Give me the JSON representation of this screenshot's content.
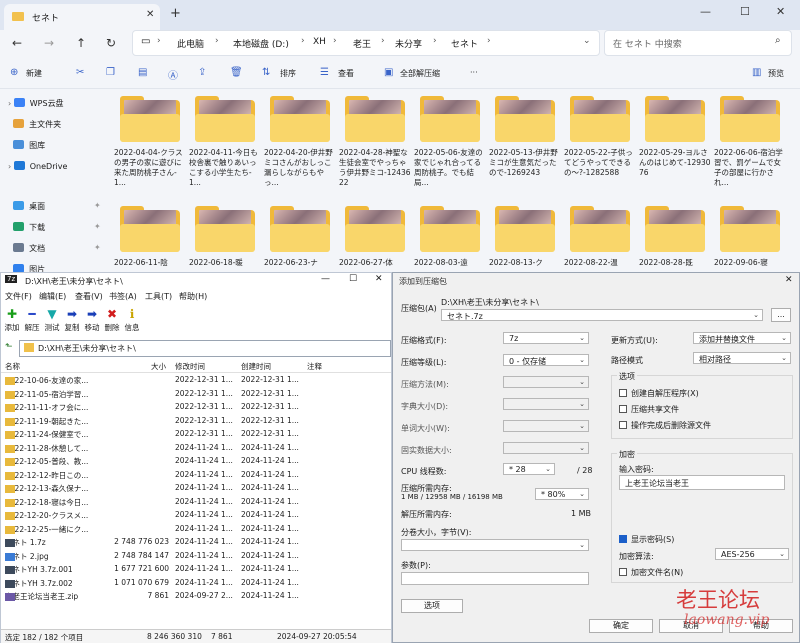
{
  "explorer": {
    "tab_title": "セネト",
    "add_tab": "+",
    "nav": {
      "back": "←",
      "forward": "→",
      "up": "↑",
      "refresh": "↻"
    },
    "breadcrumbs": [
      "此电脑",
      "本地磁盘 (D:)",
      "XH",
      "老王",
      "未分享",
      "セネト"
    ],
    "search_placeholder": "在 セネト 中搜索",
    "commands": {
      "new": "新建",
      "sort": "排序",
      "view": "查看",
      "extract_all": "全部解压缩",
      "preview": "预览"
    },
    "nav_items": [
      {
        "label": "WPS云盘",
        "icon": "cloud-icon"
      },
      {
        "label": "主文件夹",
        "icon": "home-icon"
      },
      {
        "label": "图库",
        "icon": "gallery-icon"
      },
      {
        "label": "OneDrive",
        "icon": "onedrive-icon"
      },
      {
        "label": "桌面",
        "icon": "desktop-icon"
      },
      {
        "label": "下载",
        "icon": "download-icon"
      },
      {
        "label": "文档",
        "icon": "document-icon"
      },
      {
        "label": "图片",
        "icon": "picture-icon"
      }
    ],
    "folders_row1": [
      "2022-04-04-クラスの男子の家に遊びに来た周防桃子さん-1...",
      "2022-04-11-今日も校舎裏で触りあいっこする小学生たち-1...",
      "2022-04-20-伊井野ミコさんがおしっこ漏らしながらもやっ...",
      "2022-04-28-神聖な生徒会室でやっちゃう伊井野ミコ-1243622",
      "2022-05-06-友達の家でじゃれ合ってる周防桃子。でも結局...",
      "2022-05-13-伊井野ミコが生意気だったので-1269243",
      "2022-05-22-子供ってどうやってできるの～?-1282588",
      "2022-05-29-ヨルさんのはじめて-1293076",
      "2022-06-06-宿泊学習で、罰ゲームで女子の部屋に行かされ..."
    ],
    "folders_row2": [
      "2022-06-11-陰",
      "2022-06-18-暖",
      "2022-06-23-ナ",
      "2022-06-27-体",
      "2022-08-03-遠",
      "2022-08-13-ク",
      "2022-08-22-温",
      "2022-08-28-既",
      "2022-09-06-寝"
    ]
  },
  "fm": {
    "title": "D:\\XH\\老王\\未分享\\セネト\\",
    "app_icon": "7z",
    "menu": [
      "文件(F)",
      "编辑(E)",
      "查看(V)",
      "书签(A)",
      "工具(T)",
      "帮助(H)"
    ],
    "tools": [
      {
        "label": "添加",
        "glyph": "✚",
        "color": "#1a9e1a"
      },
      {
        "label": "解压",
        "glyph": "━",
        "color": "#2a49c9"
      },
      {
        "label": "测试",
        "glyph": "▼",
        "color": "#16a8a8"
      },
      {
        "label": "复制",
        "glyph": "➡",
        "color": "#1a3fb8"
      },
      {
        "label": "移动",
        "glyph": "➡",
        "color": "#1a3fb8"
      },
      {
        "label": "删除",
        "glyph": "✖",
        "color": "#d21d1d"
      },
      {
        "label": "信息",
        "glyph": "ℹ",
        "color": "#c9a400"
      }
    ],
    "path": "D:\\XH\\老王\\未分享\\セネト\\",
    "columns": [
      "名称",
      "大小",
      "修改时间",
      "创建时间",
      "注释"
    ],
    "rows": [
      {
        "name": "2022-10-06-友達の家...",
        "size": "",
        "mtime": "2022-12-31 1...",
        "ctime": "2022-12-31 1...",
        "type": "folder"
      },
      {
        "name": "2022-11-05-宿泊学習...",
        "size": "",
        "mtime": "2022-12-31 1...",
        "ctime": "2022-12-31 1...",
        "type": "folder"
      },
      {
        "name": "2022-11-11-オフ会に...",
        "size": "",
        "mtime": "2022-12-31 1...",
        "ctime": "2022-12-31 1...",
        "type": "folder"
      },
      {
        "name": "2022-11-19-朝起きた...",
        "size": "",
        "mtime": "2022-12-31 1...",
        "ctime": "2022-12-31 1...",
        "type": "folder"
      },
      {
        "name": "2022-11-24-保健室で...",
        "size": "",
        "mtime": "2022-12-31 1...",
        "ctime": "2022-12-31 1...",
        "type": "folder"
      },
      {
        "name": "2022-11-28-休憩して...",
        "size": "",
        "mtime": "2024-11-24 1...",
        "ctime": "2024-11-24 1...",
        "type": "folder"
      },
      {
        "name": "2022-12-05-普段、教...",
        "size": "",
        "mtime": "2024-11-24 1...",
        "ctime": "2024-11-24 1...",
        "type": "folder"
      },
      {
        "name": "2022-12-12-昨日この...",
        "size": "",
        "mtime": "2024-11-24 1...",
        "ctime": "2024-11-24 1...",
        "type": "folder"
      },
      {
        "name": "2022-12-13-森久保ナ...",
        "size": "",
        "mtime": "2024-11-24 1...",
        "ctime": "2024-11-24 1...",
        "type": "folder"
      },
      {
        "name": "2022-12-18-寝は今日...",
        "size": "",
        "mtime": "2024-11-24 1...",
        "ctime": "2024-11-24 1...",
        "type": "folder"
      },
      {
        "name": "2022-12-20-クラスメ...",
        "size": "",
        "mtime": "2024-11-24 1...",
        "ctime": "2024-11-24 1...",
        "type": "folder"
      },
      {
        "name": "2022-12-25-一緒にク...",
        "size": "",
        "mtime": "2024-11-24 1...",
        "ctime": "2024-11-24 1...",
        "type": "folder"
      },
      {
        "name": "セネト 1.7z",
        "size": "2 748 776 023",
        "mtime": "2024-11-24 1...",
        "ctime": "2024-11-24 1...",
        "type": "archive"
      },
      {
        "name": "セネト 2.jpg",
        "size": "2 748 784 147",
        "mtime": "2024-11-24 1...",
        "ctime": "2024-11-24 1...",
        "type": "image"
      },
      {
        "name": "セネトYH 3.7z.001",
        "size": "1 677 721 600",
        "mtime": "2024-11-24 1...",
        "ctime": "2024-11-24 1...",
        "type": "archive"
      },
      {
        "name": "セネトYH 3.7z.002",
        "size": "1 071 070 679",
        "mtime": "2024-11-24 1...",
        "ctime": "2024-11-24 1...",
        "type": "archive"
      },
      {
        "name": "上老王论坛当老王.zip",
        "size": "7 861",
        "mtime": "2024-09-27 2...",
        "ctime": "2024-11-24 1...",
        "type": "zip"
      }
    ],
    "status": {
      "selected": "选定 182 / 182 个项目",
      "total": "8 246 360 310",
      "sel_size": "7 861",
      "date": "2024-09-27 20:05:54"
    }
  },
  "dialog": {
    "title": "添加到压缩包",
    "archive_label": "压缩包(A)",
    "archive_path": "D:\\XH\\老王\\未分享\\セネト\\",
    "archive_name": "セネト.7z",
    "browse": "...",
    "left_fields": [
      {
        "label": "压缩格式(F):",
        "value": "7z",
        "enabled": true
      },
      {
        "label": "压缩等级(L):",
        "value": "0 - 仅存储",
        "enabled": true
      },
      {
        "label": "压缩方法(M):",
        "value": "",
        "enabled": false
      },
      {
        "label": "字典大小(D):",
        "value": "",
        "enabled": false
      },
      {
        "label": "单词大小(W):",
        "value": "",
        "enabled": false
      },
      {
        "label": "固实数据大小:",
        "value": "",
        "enabled": false
      }
    ],
    "threads_label": "CPU 线程数:",
    "threads_value": "* 28",
    "threads_max": "/ 28",
    "mem_label": "压缩所需内存:",
    "mem_detail": "1 MB / 12958 MB / 16198 MB",
    "mem_value": "* 80%",
    "decomp_label": "解压所需内存:",
    "decomp_value": "1 MB",
    "split_label": "分卷大小，字节(V):",
    "params_label": "参数(P):",
    "options_btn": "选项",
    "update_label": "更新方式(U):",
    "update_value": "添加并替换文件",
    "pathmode_label": "路径模式",
    "pathmode_value": "相对路径",
    "options_group": "选项",
    "options": [
      {
        "label": "创建自解压程序(X)",
        "checked": false
      },
      {
        "label": "压缩共享文件",
        "checked": false
      },
      {
        "label": "操作完成后删除源文件",
        "checked": false
      }
    ],
    "encrypt_group": "加密",
    "password_label": "输入密码:",
    "password_value": "上老王论坛当老王",
    "show_password": "显示密码(S)",
    "enc_method_label": "加密算法:",
    "enc_method_value": "AES-256",
    "encrypt_names": "加密文件名(N)",
    "ok": "确定",
    "cancel": "取消",
    "help": "帮助"
  },
  "watermark": {
    "cn": "老王论坛",
    "url": "laowang.vip"
  }
}
